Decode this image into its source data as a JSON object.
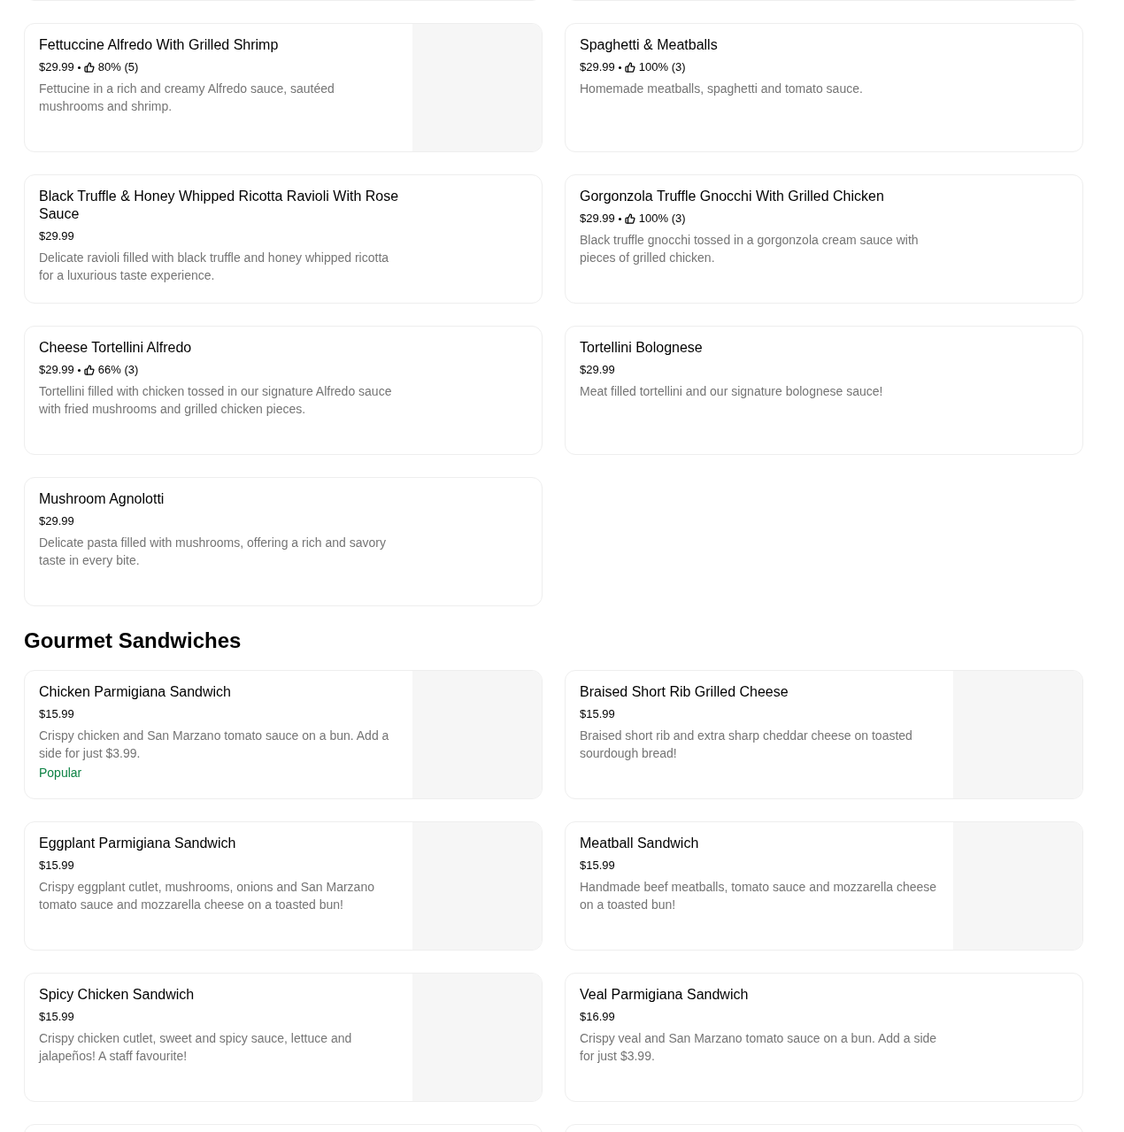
{
  "sections": [
    {
      "items": [
        {
          "kind": "with_image",
          "name": "Fettuccine Alfredo With Grilled Shrimp",
          "price": "$29.99",
          "rating": "80% (5)",
          "description": "Fettucine in a rich and creamy Alfredo sauce, sautéed mushrooms and shrimp."
        },
        {
          "kind": "text_only",
          "name": "Spaghetti & Meatballs",
          "price": "$29.99",
          "rating": "100% (3)",
          "description": "Homemade meatballs, spaghetti and tomato sauce."
        },
        {
          "kind": "text_only",
          "name": "Black Truffle & Honey Whipped Ricotta Ravioli With Rose Sauce",
          "price": "$29.99",
          "description": "Delicate ravioli filled with black truffle and honey whipped ricotta for a luxurious taste experience."
        },
        {
          "kind": "text_only",
          "name": "Gorgonzola Truffle Gnocchi With Grilled Chicken",
          "price": "$29.99",
          "rating": "100% (3)",
          "description": "Black truffle gnocchi tossed in a gorgonzola cream sauce with pieces of grilled chicken."
        },
        {
          "kind": "text_only",
          "name": "Cheese Tortellini Alfredo",
          "price": "$29.99",
          "rating": "66% (3)",
          "description": "Tortellini filled with chicken tossed in our signature Alfredo sauce with fried mushrooms and grilled chicken pieces."
        },
        {
          "kind": "text_only",
          "name": "Tortellini Bolognese",
          "price": "$29.99",
          "description": "Meat filled tortellini and our signature bolognese sauce!"
        },
        {
          "kind": "text_only",
          "name": "Mushroom Agnolotti",
          "price": "$29.99",
          "description": "Delicate pasta filled with mushrooms, offering a rich and savory taste in every bite."
        }
      ]
    },
    {
      "title": "Gourmet Sandwiches",
      "items": [
        {
          "kind": "with_image",
          "name": "Chicken Parmigiana Sandwich",
          "price": "$15.99",
          "description": "Crispy chicken and San Marzano tomato sauce on a bun. Add a side for just $3.99.",
          "badge": "Popular"
        },
        {
          "kind": "with_image",
          "name": "Braised Short Rib Grilled Cheese",
          "price": "$15.99",
          "description": "Braised short rib and extra sharp cheddar cheese on toasted sourdough bread!"
        },
        {
          "kind": "with_image",
          "name": "Eggplant Parmigiana Sandwich",
          "price": "$15.99",
          "description": "Crispy eggplant cutlet, mushrooms, onions and San Marzano tomato sauce and mozzarella cheese on a toasted bun!"
        },
        {
          "kind": "with_image",
          "name": "Meatball Sandwich",
          "price": "$15.99",
          "description": "Handmade beef meatballs, tomato sauce and mozzarella cheese on a toasted bun!"
        },
        {
          "kind": "with_image",
          "name": "Spicy Chicken Sandwich",
          "price": "$15.99",
          "description": "Crispy chicken cutlet, sweet and spicy sauce, lettuce and jalapeños! A staff favourite!"
        },
        {
          "kind": "text_only",
          "name": "Veal Parmigiana Sandwich",
          "price": "$16.99",
          "description": "Crispy veal and San Marzano tomato sauce on a bun. Add a side for just $3.99."
        }
      ]
    }
  ]
}
